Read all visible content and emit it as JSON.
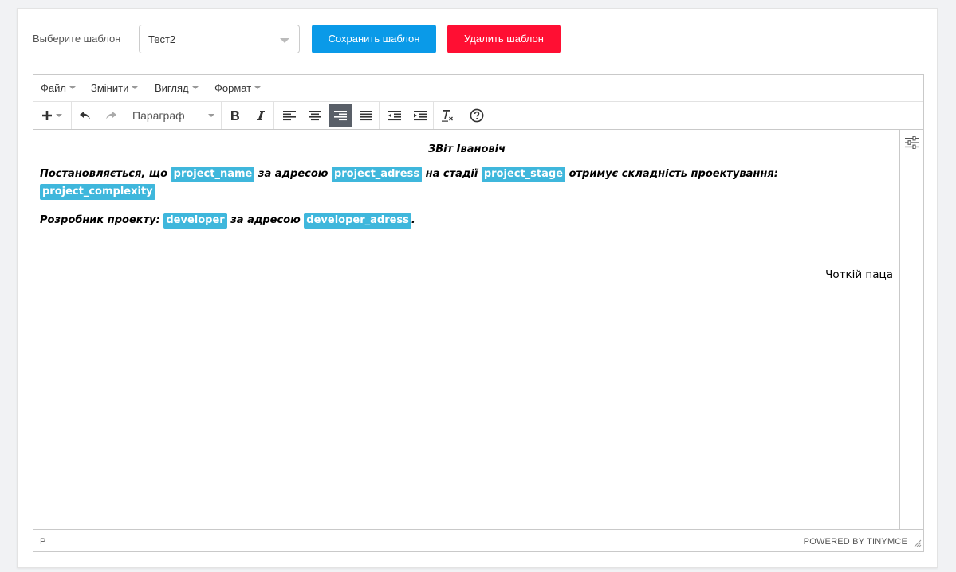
{
  "header": {
    "select_label": "Выберите шаблон",
    "selected_template": "Тест2",
    "save_label": "Сохранить шаблон",
    "delete_label": "Удалить шаблон"
  },
  "menubar": {
    "items": [
      "Файл",
      "Змінити",
      "Вигляд",
      "Формат"
    ]
  },
  "toolbar": {
    "block_format": "Параграф",
    "icons": [
      "insert-plus-icon",
      "undo-icon",
      "redo-icon",
      "bold-icon",
      "italic-icon",
      "align-left-icon",
      "align-center-icon",
      "align-right-icon",
      "align-justify-icon",
      "outdent-icon",
      "indent-icon",
      "clear-format-icon",
      "help-icon"
    ],
    "active": "align-right-icon"
  },
  "content": {
    "title": "ЗВіт Івановіч",
    "p1_text1": "Постановляється, що ",
    "p1_tag1": "project_name",
    "p1_text2": " за адресою ",
    "p1_tag2": "project_adress",
    "p1_text3": " на стадії ",
    "p1_tag3": "project_stage",
    "p1_text4": " отримує складність проектування: ",
    "p1_tag4": "project_complexity",
    "p2_text1": "Розробник проекту: ",
    "p2_tag1": "developer",
    "p2_text2": " за адресою ",
    "p2_tag2": "developer_adress",
    "p2_text3": ".",
    "right_text": "Чоткій паца"
  },
  "statusbar": {
    "path": "P",
    "brand": "POWERED BY TINYMCE"
  },
  "colors": {
    "save_button": "#0a9ae8",
    "delete_button": "#ff0f33",
    "tag_background": "#3fb7dc",
    "active_toolbar": "#595f68"
  }
}
